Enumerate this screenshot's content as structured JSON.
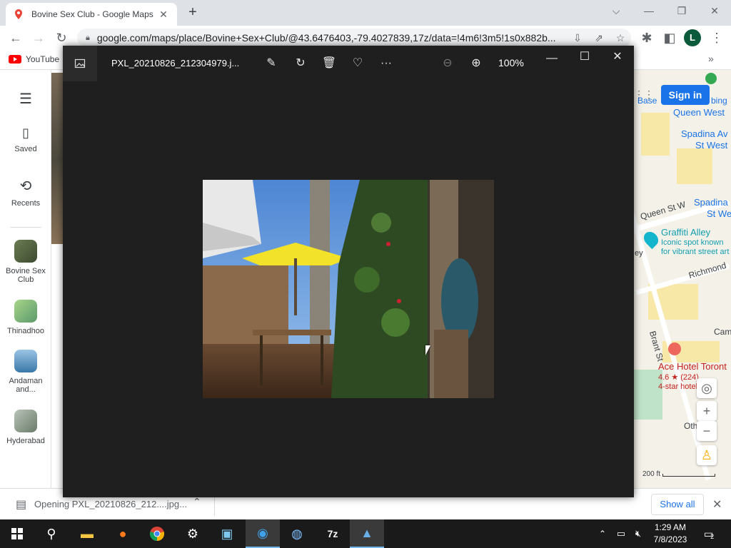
{
  "browser": {
    "tab_title": "Bovine Sex Club - Google Maps",
    "url": "google.com/maps/place/Bovine+Sex+Club/@43.6476403,-79.4027839,17z/data=!4m6!3m5!1s0x882b...",
    "avatar_letter": "L",
    "bookmark_label": "YouTube"
  },
  "maps_sidebar": {
    "menu_icon": "hamburger-icon",
    "saved_label": "Saved",
    "recents_label": "Recents",
    "places": [
      {
        "label": "Bovine Sex Club",
        "color": "#5a6b4a"
      },
      {
        "label": "Thinadhoo",
        "color": "#7fae7a"
      },
      {
        "label": "Andaman and...",
        "color": "#4a8ab8"
      },
      {
        "label": "Hyderabad",
        "color": "#8a9a8a"
      }
    ]
  },
  "map": {
    "signin_label": "Sign in",
    "labels": {
      "bathurst": "Base",
      "bathurst2": "bing",
      "queen_west": "Queen West",
      "spadina_av": "Spadina Av",
      "st_west": "St West",
      "queen_st_w": "Queen St W",
      "spadina2": "Spadina",
      "st_we": "St We",
      "graffiti_alley": "Graffiti Alley",
      "graffiti_desc1": "Iconic spot known",
      "graffiti_desc2": "for vibrant street art",
      "richmond": "Richmond",
      "brant_st": "Brant St",
      "cam": "Cam",
      "ace_hotel": "Ace Hotel Toront",
      "ace_rating": "4.6 ★ (224)",
      "ace_type": "4-star hotel",
      "oth": "Oth",
      "scale": "200 ft",
      "left_edge": "ey"
    }
  },
  "downloads": {
    "file_text": "Opening PXL_20210826_212....jpg...",
    "show_all_label": "Show all"
  },
  "viewer": {
    "filename": "PXL_20210826_212304979.j...",
    "zoom": "100%"
  },
  "taskbar": {
    "time": "1:29 AM",
    "date": "7/8/2023",
    "notification_count": "2"
  }
}
